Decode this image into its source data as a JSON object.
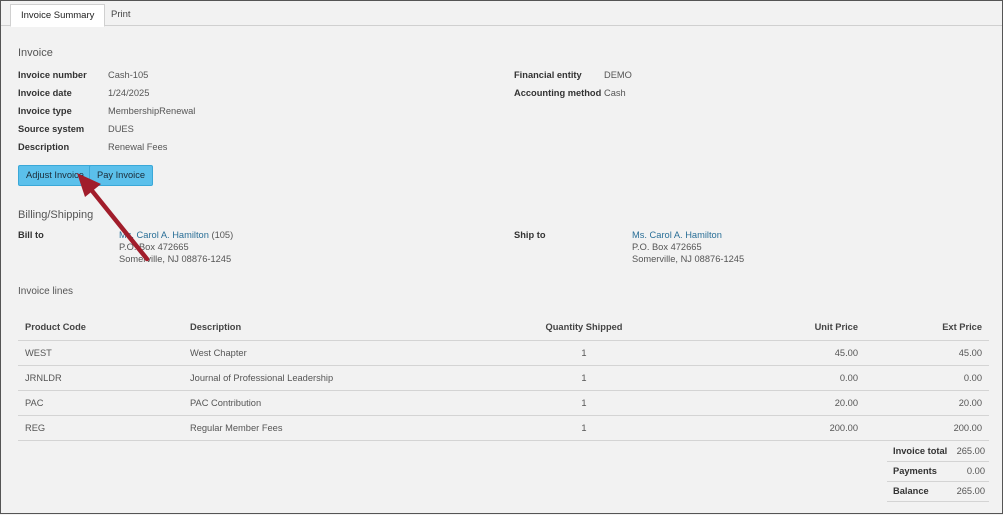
{
  "tabs": [
    {
      "label": "Invoice Summary"
    },
    {
      "label": "Print"
    }
  ],
  "invoice": {
    "heading": "Invoice",
    "number_label": "Invoice number",
    "number": "Cash-105",
    "date_label": "Invoice date",
    "date": "1/24/2025",
    "type_label": "Invoice type",
    "type": "MembershipRenewal",
    "source_label": "Source system",
    "source": "DUES",
    "description_label": "Description",
    "description": "Renewal Fees",
    "entity_label": "Financial entity",
    "entity": "DEMO",
    "method_label": "Accounting method",
    "method": "Cash"
  },
  "buttons": {
    "adjust": "Adjust Invoice",
    "pay": "Pay Invoice"
  },
  "billing": {
    "heading": "Billing/Shipping",
    "bill_label": "Bill to",
    "bill_name": "Ms. Carol A. Hamilton",
    "bill_id": "(105)",
    "bill_line1": "P.O. Box 472665",
    "bill_line2": "Somerville, NJ 08876-1245",
    "ship_label": "Ship to",
    "ship_name": "Ms. Carol A. Hamilton",
    "ship_line1": "P.O. Box 472665",
    "ship_line2": "Somerville, NJ 08876-1245"
  },
  "lines": {
    "heading": "Invoice lines",
    "headers": {
      "code": "Product Code",
      "desc": "Description",
      "qty": "Quantity Shipped",
      "unit": "Unit Price",
      "ext": "Ext Price"
    },
    "rows": [
      {
        "code": "WEST",
        "desc": "West Chapter",
        "qty": "1",
        "unit": "45.00",
        "ext": "45.00"
      },
      {
        "code": "JRNLDR",
        "desc": "Journal of Professional Leadership",
        "qty": "1",
        "unit": "0.00",
        "ext": "0.00"
      },
      {
        "code": "PAC",
        "desc": "PAC Contribution",
        "qty": "1",
        "unit": "20.00",
        "ext": "20.00"
      },
      {
        "code": "REG",
        "desc": "Regular Member Fees",
        "qty": "1",
        "unit": "200.00",
        "ext": "200.00"
      }
    ]
  },
  "totals": {
    "total_label": "Invoice total",
    "total": "265.00",
    "payments_label": "Payments",
    "payments": "0.00",
    "balance_label": "Balance",
    "balance": "265.00"
  },
  "colors": {
    "accent": "#5bc0eb",
    "link": "#2a6f97",
    "arrow": "#a11d2b"
  }
}
